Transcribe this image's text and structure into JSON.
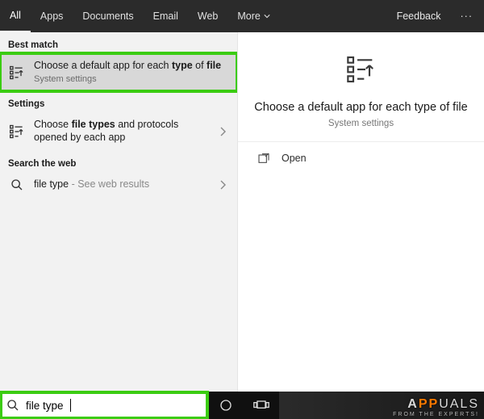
{
  "tabs": {
    "items": [
      "All",
      "Apps",
      "Documents",
      "Email",
      "Web",
      "More"
    ],
    "feedback": "Feedback"
  },
  "sections": {
    "best_match": "Best match",
    "settings": "Settings",
    "search_web": "Search the web"
  },
  "results": {
    "best": {
      "pre": "Choose a default app for each ",
      "bold": "type",
      "mid": " of ",
      "bold2": "file",
      "sub": "System settings"
    },
    "setting1": {
      "pre": "Choose ",
      "bold": "file types",
      "post": " and protocols opened by each app"
    },
    "web1": {
      "term": "file type",
      "hint": " - See web results"
    }
  },
  "detail": {
    "title": "Choose a default app for each type of file",
    "sub": "System settings",
    "open": "Open"
  },
  "search": {
    "value": "file type"
  },
  "watermark": {
    "brand_a": "A",
    "brand_b": "UALS",
    "tag": "FROM THE EXPERTS!"
  }
}
